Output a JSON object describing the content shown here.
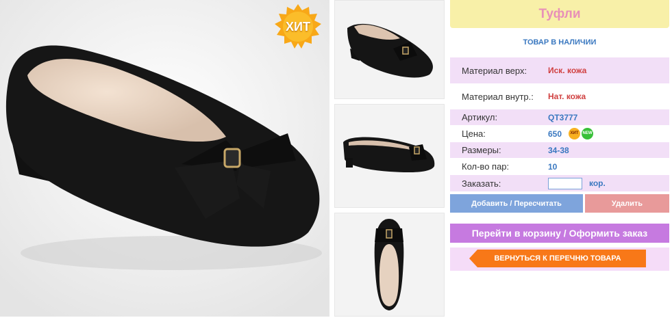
{
  "badge": {
    "hit": "ХИТ"
  },
  "product": {
    "title": "Туфли",
    "stock": "ТОВАР В НАЛИЧИИ",
    "material_top_label": "Материал верх:",
    "material_top_value": "Иск. кожа",
    "material_inner_label": "Материал внутр.:",
    "material_inner_value": "Нат. кожа",
    "article_label": "Артикул:",
    "article_value": "QT3777",
    "price_label": "Цена:",
    "price_value": "650",
    "price_badge_hit": "ХИТ",
    "price_badge_new": "NEW",
    "sizes_label": "Размеры:",
    "sizes_value": "34-38",
    "pairs_label": "Кол-во пар:",
    "pairs_value": "10",
    "order_label": "Заказать:",
    "order_unit": "кор."
  },
  "buttons": {
    "add": "Добавить / Пересчитать",
    "delete": "Удалить",
    "cart": "Перейти в корзину / Оформить заказ",
    "back": "ВЕРНУТЬСЯ К ПЕРЕЧНЮ ТОВАРА"
  },
  "colors": {
    "title_bg": "#f8f0a8",
    "title_text": "#e890b8",
    "accent_blue": "#3a78c0",
    "value_red": "#d04040",
    "row_shade": "#f2dff7",
    "button_add": "#7ea4dc",
    "button_delete": "#e89a9a",
    "button_cart": "#c67ae0",
    "button_back": "#f87818"
  },
  "images": [
    {
      "name": "main-photo",
      "icon": "black-ballet-flat-with-bow"
    },
    {
      "name": "thumbnail-side",
      "icon": "black-ballet-flat-with-bow"
    },
    {
      "name": "thumbnail-profile",
      "icon": "black-ballet-flat-with-bow"
    },
    {
      "name": "thumbnail-top",
      "icon": "black-ballet-flat-top-view"
    }
  ]
}
